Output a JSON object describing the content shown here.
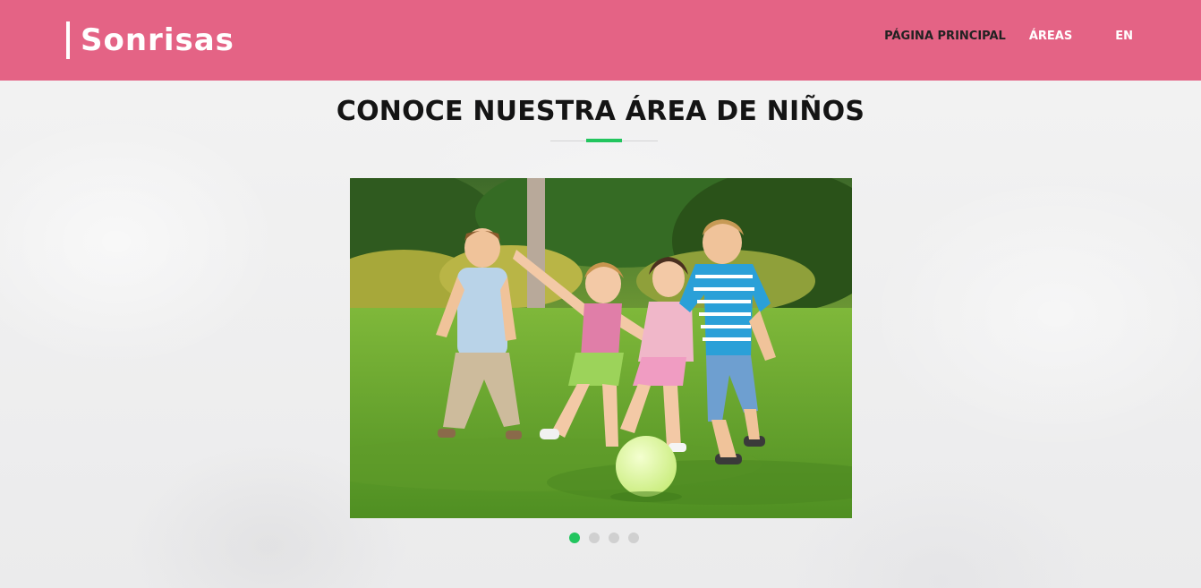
{
  "header": {
    "logo": "Sonrisas",
    "background_color": "#e46385"
  },
  "nav": {
    "items": [
      {
        "label": "PÁGINA PRINCIPAL"
      },
      {
        "label": "ÁREAS"
      },
      {
        "label": "EN"
      }
    ]
  },
  "section": {
    "title": "CONOCE NUESTRA ÁREA DE NIÑOS",
    "accent_color": "#22c55e"
  },
  "carousel": {
    "slide_image": "children-playing-ball-on-grass",
    "slide_count": 4,
    "active_index": 0
  }
}
